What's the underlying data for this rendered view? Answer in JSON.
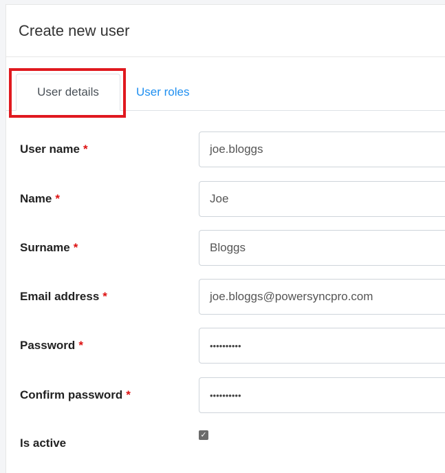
{
  "dialog": {
    "title": "Create new user"
  },
  "tabs": [
    {
      "label": "User details",
      "active": true
    },
    {
      "label": "User roles",
      "active": false
    }
  ],
  "required_marker": "*",
  "fields": {
    "username": {
      "label": "User name",
      "value": "joe.bloggs"
    },
    "name": {
      "label": "Name",
      "value": "Joe"
    },
    "surname": {
      "label": "Surname",
      "value": "Bloggs"
    },
    "email": {
      "label": "Email address",
      "value": "joe.bloggs@powersyncpro.com"
    },
    "password": {
      "label": "Password",
      "value": "••••••••••"
    },
    "confirm_password": {
      "label": "Confirm password",
      "value": "••••••••••"
    },
    "is_active": {
      "label": "Is active",
      "checked": true
    }
  },
  "colors": {
    "link": "#1f8ff0",
    "required": "#dd1111",
    "highlight": "#e0191f"
  }
}
